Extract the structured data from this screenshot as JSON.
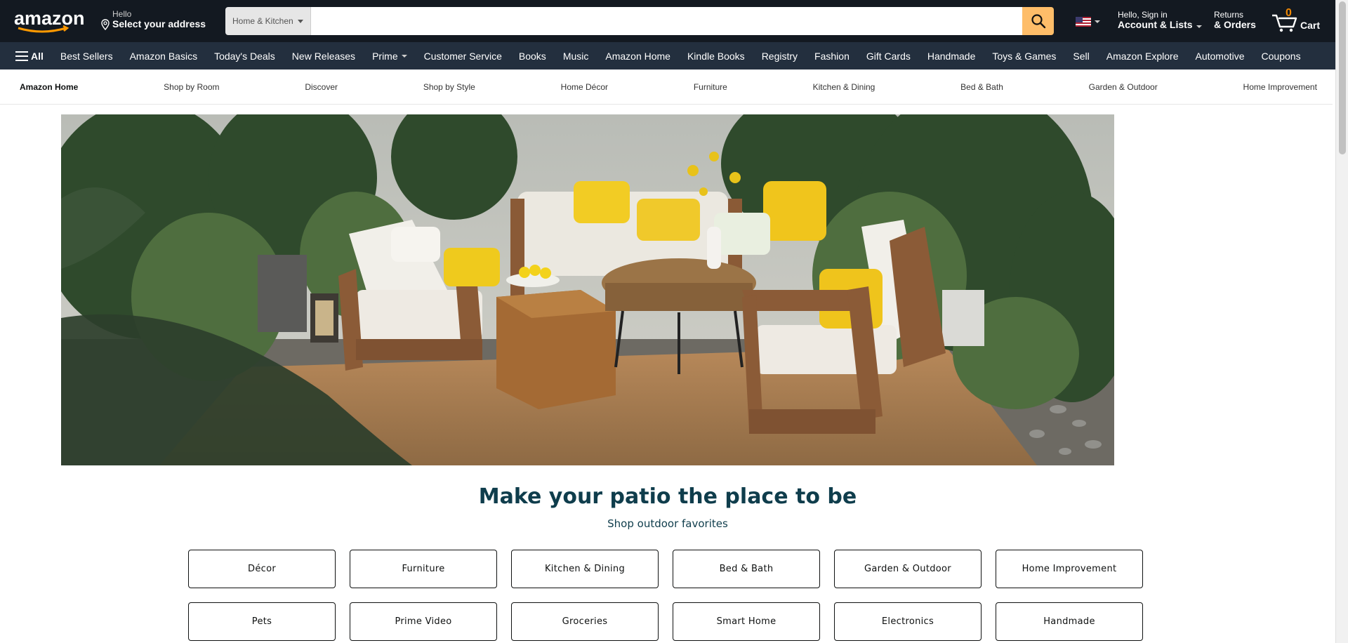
{
  "header": {
    "logo_text": "amazon",
    "deliver_hello": "Hello",
    "deliver_address": "Select your address",
    "search_category": "Home & Kitchen",
    "search_placeholder": "",
    "account_line1": "Hello, Sign in",
    "account_line2": "Account & Lists",
    "returns_line1": "Returns",
    "returns_line2": "& Orders",
    "cart_count": "0",
    "cart_label": "Cart"
  },
  "nav": {
    "all_label": "All",
    "items": [
      "Best Sellers",
      "Amazon Basics",
      "Today's Deals",
      "New Releases",
      "Prime",
      "Customer Service",
      "Books",
      "Music",
      "Amazon Home",
      "Kindle Books",
      "Registry",
      "Fashion",
      "Gift Cards",
      "Handmade",
      "Toys & Games",
      "Sell",
      "Amazon Explore",
      "Automotive",
      "Coupons"
    ]
  },
  "subnav": {
    "items": [
      "Amazon Home",
      "Shop by Room",
      "Discover",
      "Shop by Style",
      "Home Décor",
      "Furniture",
      "Kitchen & Dining",
      "Bed & Bath",
      "Garden & Outdoor",
      "Home Improvement"
    ]
  },
  "hero": {
    "heading": "Make your patio the place to be",
    "subheading": "Shop outdoor favorites"
  },
  "categories": {
    "row1": [
      "Décor",
      "Furniture",
      "Kitchen & Dining",
      "Bed & Bath",
      "Garden & Outdoor",
      "Home Improvement"
    ],
    "row2": [
      "Pets",
      "Prime Video",
      "Groceries",
      "Smart Home",
      "Electronics",
      "Handmade"
    ]
  },
  "colors": {
    "topbar": "#131921",
    "nav2": "#232f3e",
    "search_button": "#febd69",
    "cart_count": "#f08804",
    "heading": "#0f3d4c"
  }
}
